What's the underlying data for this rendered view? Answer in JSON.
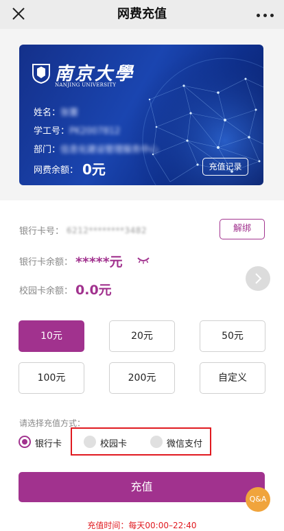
{
  "header": {
    "title": "网费充值",
    "close_icon": "close-icon",
    "more_icon": "more-icon"
  },
  "card": {
    "university_name": "南京大學",
    "university_name_en": "NANJING UNIVERSITY",
    "name_label": "姓名：",
    "name_value": "张蕾",
    "id_label": "学工号：",
    "id_value": "PK2007812",
    "dept_label": "部门：",
    "dept_value": "信息化建设管理服务中心",
    "balance_label": "网费余额：",
    "balance_value": "0元",
    "record_button": "充值记录"
  },
  "account": {
    "bank_no_label": "银行卡号：",
    "bank_no_value": "6212********3482",
    "unbind_button": "解绑",
    "bank_balance_label": "银行卡余额：",
    "bank_balance_value": "*****元",
    "campus_balance_label": "校园卡余额：",
    "campus_balance_value": "0.0元"
  },
  "amounts": {
    "options": [
      "10元",
      "20元",
      "50元",
      "100元",
      "200元",
      "自定义"
    ],
    "selected": "10元"
  },
  "payment": {
    "label": "请选择充值方式：",
    "methods": [
      "银行卡",
      "校园卡",
      "微信支付"
    ],
    "selected": "银行卡"
  },
  "submit_button": "充值",
  "qa_button": "Q&A",
  "recharge_time": "充值时间：每天00:00–22:40",
  "colors": {
    "accent": "#a1328e",
    "highlight_box": "#e0191f",
    "qa": "#f0a43c",
    "card_blue": "#1a45b0"
  }
}
